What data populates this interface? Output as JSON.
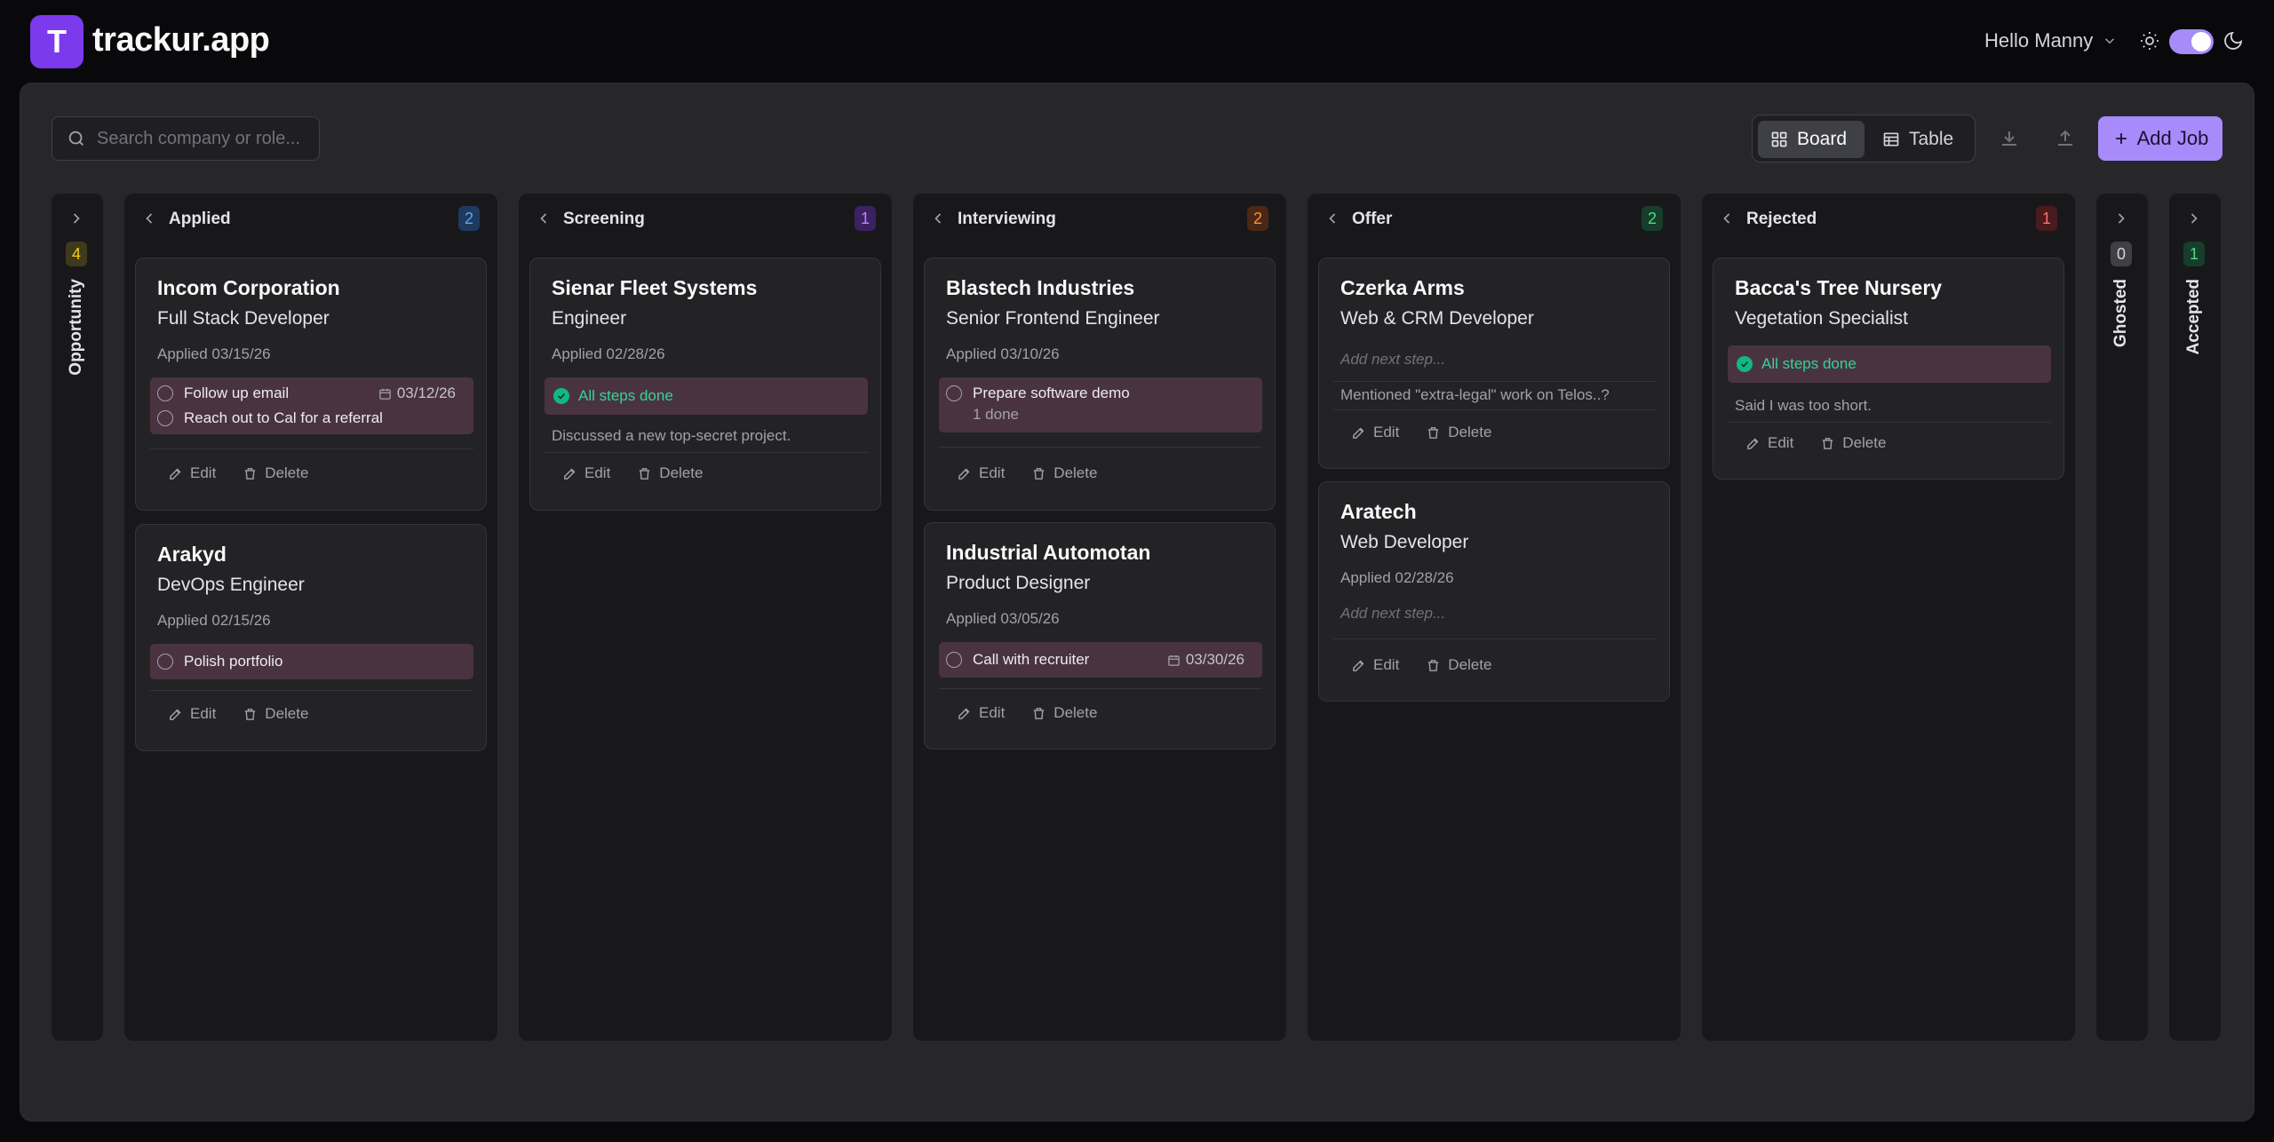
{
  "app": {
    "logo_letter": "T",
    "name": "trackur.app"
  },
  "user": {
    "greeting": "Hello Manny"
  },
  "search": {
    "placeholder": "Search company or role..."
  },
  "views": {
    "board": "Board",
    "table": "Table",
    "active": "Board"
  },
  "toolbar": {
    "add_job": "Add Job"
  },
  "theme": {
    "dark_mode": true,
    "accent": "#a78bfa"
  },
  "actions": {
    "edit": "Edit",
    "delete": "Delete"
  },
  "columns": {
    "opportunity": {
      "title": "Opportunity",
      "count": "4",
      "collapsed": true
    },
    "applied": {
      "title": "Applied",
      "count": "2"
    },
    "screening": {
      "title": "Screening",
      "count": "1"
    },
    "interviewing": {
      "title": "Interviewing",
      "count": "2"
    },
    "offer": {
      "title": "Offer",
      "count": "2"
    },
    "rejected": {
      "title": "Rejected",
      "count": "1"
    },
    "ghosted": {
      "title": "Ghosted",
      "count": "0",
      "collapsed": true
    },
    "accepted": {
      "title": "Accepted",
      "count": "1",
      "collapsed": true
    }
  },
  "cards": {
    "incom": {
      "company": "Incom Corporation",
      "role": "Full Stack Developer",
      "applied": "Applied 03/15/26",
      "steps": [
        {
          "label": "Follow up email",
          "date": "03/12/26"
        },
        {
          "label": "Reach out to Cal for a referral"
        }
      ]
    },
    "arakyd": {
      "company": "Arakyd",
      "role": "DevOps Engineer",
      "applied": "Applied 02/15/26",
      "steps": [
        {
          "label": "Polish portfolio"
        }
      ]
    },
    "sienar": {
      "company": "Sienar Fleet Systems",
      "role": "Engineer",
      "applied": "Applied 02/28/26",
      "status": "All steps done",
      "note": "Discussed a new top-secret project."
    },
    "blastech": {
      "company": "Blastech Industries",
      "role": "Senior Frontend Engineer",
      "applied": "Applied 03/10/26",
      "steps": [
        {
          "label": "Prepare software demo",
          "sub": "1 done"
        }
      ]
    },
    "industrial": {
      "company": "Industrial Automotan",
      "role": "Product Designer",
      "applied": "Applied 03/05/26",
      "steps": [
        {
          "label": "Call with recruiter",
          "date": "03/30/26"
        }
      ]
    },
    "czerka": {
      "company": "Czerka Arms",
      "role": "Web & CRM Developer",
      "next_step": "Add next step...",
      "note": "Mentioned \"extra-legal\" work on Telos..?"
    },
    "aratech": {
      "company": "Aratech",
      "role": "Web Developer",
      "applied": "Applied 02/28/26",
      "next_step": "Add next step..."
    },
    "bacca": {
      "company": "Bacca's Tree Nursery",
      "role": "Vegetation Specialist",
      "status": "All steps done",
      "note": "Said I was too short."
    }
  }
}
